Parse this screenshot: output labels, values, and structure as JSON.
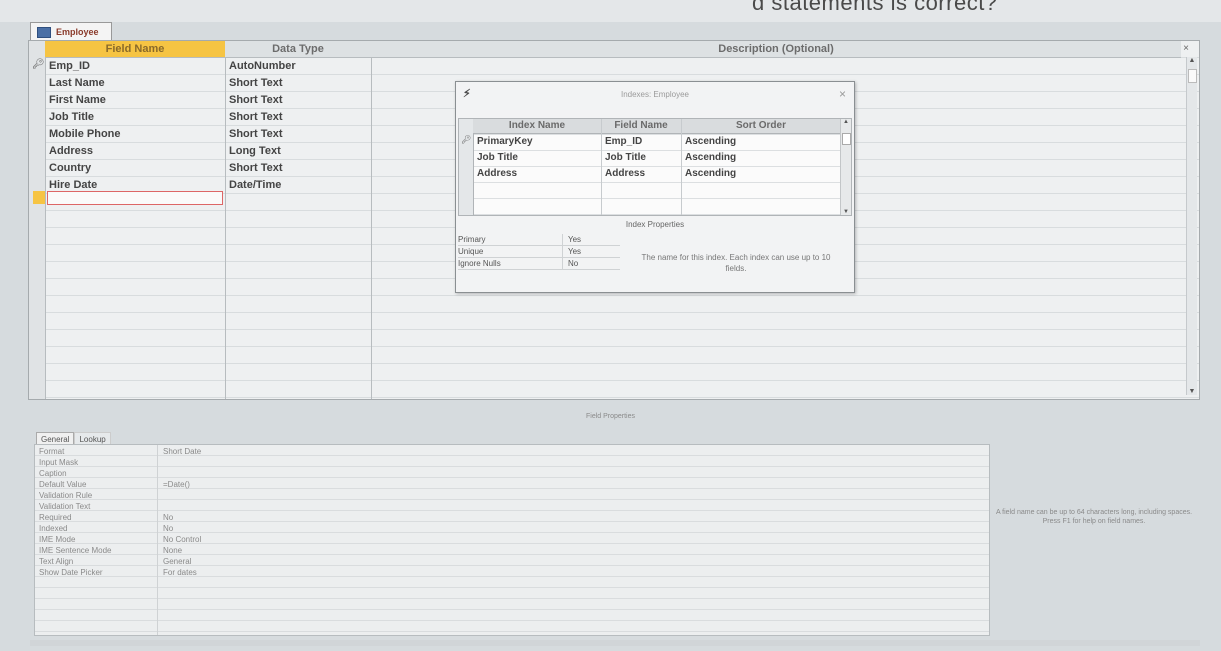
{
  "background_text": "ɑ statements is correct?",
  "tab": {
    "label": "Employee"
  },
  "design": {
    "headers": {
      "field_name": "Field Name",
      "data_type": "Data Type",
      "description": "Description (Optional)"
    },
    "rows": [
      {
        "field": "Emp_ID",
        "type": "AutoNumber"
      },
      {
        "field": "Last Name",
        "type": "Short Text"
      },
      {
        "field": "First Name",
        "type": "Short Text"
      },
      {
        "field": "Job Title",
        "type": "Short Text"
      },
      {
        "field": "Mobile Phone",
        "type": "Short Text"
      },
      {
        "field": "Address",
        "type": "Long Text"
      },
      {
        "field": "Country",
        "type": "Short Text"
      },
      {
        "field": "Hire Date",
        "type": "Date/Time"
      }
    ],
    "close_label": "×",
    "key_icon": "primary-key-icon"
  },
  "indexes": {
    "title": "Indexes: Employee",
    "close": "×",
    "headers": {
      "index_name": "Index Name",
      "field_name": "Field Name",
      "sort_order": "Sort Order"
    },
    "rows": [
      {
        "index": "PrimaryKey",
        "field": "Emp_ID",
        "sort": "Ascending"
      },
      {
        "index": "Job Title",
        "field": "Job Title",
        "sort": "Ascending"
      },
      {
        "index": "Address",
        "field": "Address",
        "sort": "Ascending"
      }
    ],
    "properties_title": "Index Properties",
    "properties": [
      {
        "name": "Primary",
        "value": "Yes"
      },
      {
        "name": "Unique",
        "value": "Yes"
      },
      {
        "name": "Ignore Nulls",
        "value": "No"
      }
    ],
    "help": "The name for this index. Each index can use up to 10 fields."
  },
  "field_properties": {
    "label": "Field Properties",
    "tabs": {
      "general": "General",
      "lookup": "Lookup"
    },
    "rows": [
      {
        "name": "Format",
        "value": "Short Date"
      },
      {
        "name": "Input Mask",
        "value": ""
      },
      {
        "name": "Caption",
        "value": ""
      },
      {
        "name": "Default Value",
        "value": "=Date()"
      },
      {
        "name": "Validation Rule",
        "value": ""
      },
      {
        "name": "Validation Text",
        "value": ""
      },
      {
        "name": "Required",
        "value": "No"
      },
      {
        "name": "Indexed",
        "value": "No"
      },
      {
        "name": "IME Mode",
        "value": "No Control"
      },
      {
        "name": "IME Sentence Mode",
        "value": "None"
      },
      {
        "name": "Text Align",
        "value": "General"
      },
      {
        "name": "Show Date Picker",
        "value": "For dates"
      }
    ],
    "help": "A field name can be up to 64 characters long, including spaces. Press F1 for help on field names."
  }
}
